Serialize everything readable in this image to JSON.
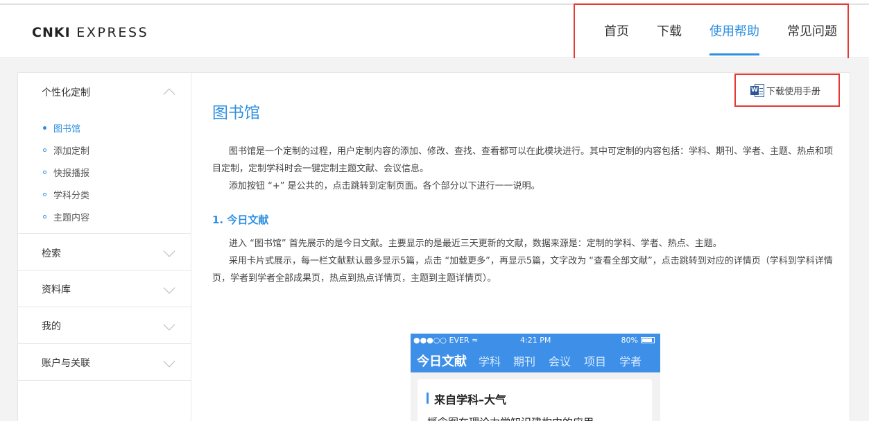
{
  "header": {
    "logo_bold": "CNKI",
    "logo_rest": "EXPRESS",
    "nav": [
      {
        "label": "首页"
      },
      {
        "label": "下载"
      },
      {
        "label": "使用帮助"
      },
      {
        "label": "常见问题"
      }
    ],
    "active_nav": "使用帮助"
  },
  "sidebar": {
    "groups": [
      {
        "title": "个性化定制",
        "expanded": true,
        "items": [
          {
            "label": "图书馆"
          },
          {
            "label": "添加定制"
          },
          {
            "label": "快报播报"
          },
          {
            "label": "学科分类"
          },
          {
            "label": "主题内容"
          }
        ],
        "active_item": "图书馆"
      },
      {
        "title": "检索",
        "expanded": false
      },
      {
        "title": "资料库",
        "expanded": false
      },
      {
        "title": "我的",
        "expanded": false
      },
      {
        "title": "账户与关联",
        "expanded": false
      }
    ]
  },
  "content": {
    "download_manual": {
      "icon": "word-document-icon",
      "label": "下载使用手册"
    },
    "title": "图书馆",
    "intro": [
      "图书馆是一个定制的过程，用户定制内容的添加、修改、查找、查看都可以在此模块进行。其中可定制的内容包括：学科、期刊、学者、主题、热点和项目定制，定制学科时会一键定制主题文献、会议信息。",
      "添加按钮 “+” 是公共的，点击跳转到定制页面。各个部分以下进行一一说明。"
    ],
    "section1_title": "1. 今日文献",
    "section1": [
      "进入 “图书馆” 首先展示的是今日文献。主要显示的是最近三天更新的文献，数据来源是：定制的学科、学者、热点、主题。",
      "采用卡片式展示，每一栏文献默认最多显示5篇，点击 “加载更多”，再显示5篇，文字改为 “查看全部文献”，点击跳转到对应的详情页（学科到学科详情页，学者到学者全部成果页，热点到热点详情页，主题到主题详情页）。"
    ],
    "phone": {
      "carrier": "●●●○○ EVER",
      "time": "4:21 PM",
      "battery": "80%",
      "tabs": [
        {
          "label": "今日文献"
        },
        {
          "label": "学科"
        },
        {
          "label": "期刊"
        },
        {
          "label": "会议"
        },
        {
          "label": "项目"
        },
        {
          "label": "学者"
        }
      ],
      "card_title": "来自学科–大气",
      "card_line": "概念图在理论力学知识建构中的应用"
    }
  },
  "colors": {
    "accent": "#2e8fe0",
    "highlight_box": "#e53935",
    "phone_blue": "#3d8fe8"
  }
}
